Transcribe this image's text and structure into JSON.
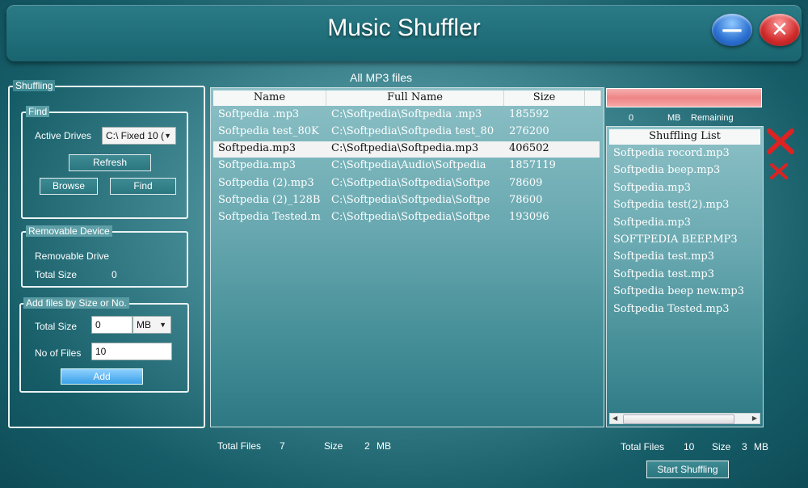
{
  "app": {
    "title": "Music Shuffler"
  },
  "window_buttons": {
    "minimize": "—",
    "close": "✕"
  },
  "shuffling": {
    "legend": "Shuffling",
    "find": {
      "legend": "Find",
      "active_drives_label": "Active Drives",
      "active_drives_value": "C:\\ Fixed 10 (",
      "refresh": "Refresh",
      "browse": "Browse",
      "find": "Find"
    },
    "removable": {
      "legend": "Removable Device",
      "drive_label": "Removable Drive",
      "total_size_label": "Total Size",
      "total_size_value": "0"
    },
    "add_files": {
      "legend": "Add files by Size or No.",
      "total_size_label": "Total Size",
      "total_size_value": "0",
      "unit": "MB",
      "no_of_files_label": "No of Files",
      "no_of_files_value": "10",
      "add_button": "Add"
    }
  },
  "mp3": {
    "title": "All MP3 files",
    "columns": [
      "Name",
      "Full Name",
      "Size"
    ],
    "rows": [
      [
        "Softpedia .mp3",
        "C:\\Softpedia\\Softpedia .mp3",
        "185592"
      ],
      [
        "Softpedia test_80K",
        "C:\\Softpedia\\Softpedia test_80",
        "276200"
      ],
      [
        "Softpedia.mp3",
        "C:\\Softpedia\\Softpedia.mp3",
        "406502"
      ],
      [
        "Softpedia.mp3",
        "C:\\Softpedia\\Audio\\Softpedia",
        "1857119"
      ],
      [
        "Softpedia (2).mp3",
        "C:\\Softpedia\\Softpedia\\Softpe",
        "78609"
      ],
      [
        "Softpedia (2)_128B",
        "C:\\Softpedia\\Softpedia\\Softpe",
        "78600"
      ],
      [
        "Softpedia Tested.m",
        "C:\\Softpedia\\Softpedia\\Softpe",
        "193096"
      ]
    ],
    "selected_row": 2,
    "total_files_label": "Total Files",
    "total_files_value": "7",
    "size_label": "Size",
    "size_value": "2",
    "size_unit": "MB"
  },
  "right": {
    "remaining_value": "0",
    "remaining_unit": "MB",
    "remaining_label": "Remaining",
    "shuffling_list_header": "Shuffling List",
    "items": [
      "Softpedia record.mp3",
      "Softpedia beep.mp3",
      "Softpedia.mp3",
      "Softpedia test(2).mp3",
      "Softpedia.mp3",
      "SOFTPEDIA BEEP.MP3",
      "Softpedia test.mp3",
      "Softpedia test.mp3",
      "Softpedia beep new.mp3",
      "Softpedia Tested.mp3"
    ],
    "total_files_label": "Total Files",
    "total_files_value": "10",
    "size_label": "Size",
    "size_value": "3",
    "size_unit": "MB",
    "start_button": "Start Shuffling"
  },
  "colors": {
    "accent_bar": "#f08c8c",
    "remove_icon": "#d22"
  }
}
